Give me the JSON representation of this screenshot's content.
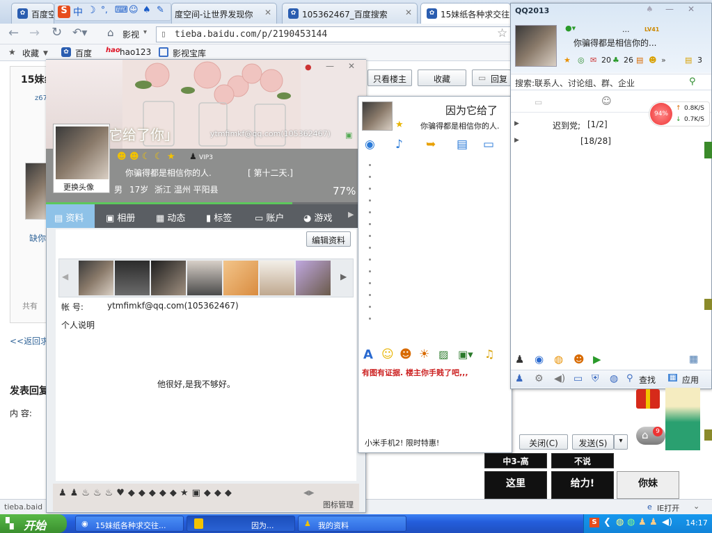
{
  "browser": {
    "tabs": [
      {
        "label": "百度空"
      },
      {
        "label": "度空间-让世界发现你"
      },
      {
        "label": "105362467_百度搜索"
      },
      {
        "label": "15妹纸各种求交往叫"
      }
    ],
    "address": "tieba.baidu.com/p/2190453144",
    "ext_label": "影视",
    "bookmarks": [
      "收藏",
      "百度",
      "hao123",
      "影视宝库"
    ],
    "status_left": "tieba.baid",
    "status_right": "IE打开"
  },
  "tieba": {
    "post_title": "15妹纟",
    "only_lz": "只看楼主",
    "favorite": "收藏",
    "reply": "回复",
    "user_short": "z67",
    "side_text": "缺你",
    "share_text": "共有",
    "back_link": "<<返回求交",
    "reply_title": "发表回复",
    "content_label": "内  容:"
  },
  "profile": {
    "banner_text": "为它给了你」",
    "email_header": "ytmfimkf@qq.com(105362467)",
    "change_avatar": "更换头像",
    "vip": "VIP3",
    "signature": "你骗得都是相信你的人.",
    "days": "[ 第十二天.]",
    "gender": "男",
    "age": "17岁",
    "location": "浙江 温州 平阳县",
    "completion": "77%",
    "completion_value": 0.77,
    "tabs": [
      "资料",
      "相册",
      "动态",
      "标签",
      "账户",
      "游戏"
    ],
    "edit": "编辑资料",
    "account_label": "帐    号:",
    "account_value": "ytmfimkf@qq.com(105362467)",
    "personal_label": "个人说明",
    "personal_text": "他很好,是我不够好。",
    "icon_manage": "图标管理"
  },
  "chat": {
    "title": "因为它给了",
    "signature": "你骗得都是相信你的人.",
    "notice": "有图有证据. 楼主你手贱了吧,,,",
    "ad": "小米手机2! 限时特惠!",
    "close": "关闭(C)",
    "send": "发送(S)"
  },
  "qq": {
    "title": "QQ2013",
    "nick_dots": "...",
    "level_badge": "LV41",
    "signature": "你骗得都是相信你的...",
    "mail_count": "20",
    "clover_count": "26",
    "coin_count": "3",
    "search": "搜索:联系人、讨论组、群、企业",
    "groups": [
      {
        "name": "迟到党;",
        "count": "[1/2]"
      },
      {
        "name": "",
        "count": "[18/28]"
      }
    ],
    "speed_pct": "94%",
    "up_speed": "0.8K/S",
    "down_speed": "0.7K/S",
    "find": "查找",
    "apps": "应用",
    "notif_count": "9"
  },
  "memes": [
    "中3-高",
    "不说",
    "给力!",
    "你妹",
    "这里"
  ],
  "taskbar": {
    "start": "开始",
    "tasks": [
      "15妹纸各种求交往...",
      "因为...",
      "我的资料"
    ],
    "clock": "14:17"
  },
  "colors": {
    "taskbar": "#245edc",
    "accent_red": "#cc2222",
    "profile_tab_active": "#8ec2e8"
  }
}
